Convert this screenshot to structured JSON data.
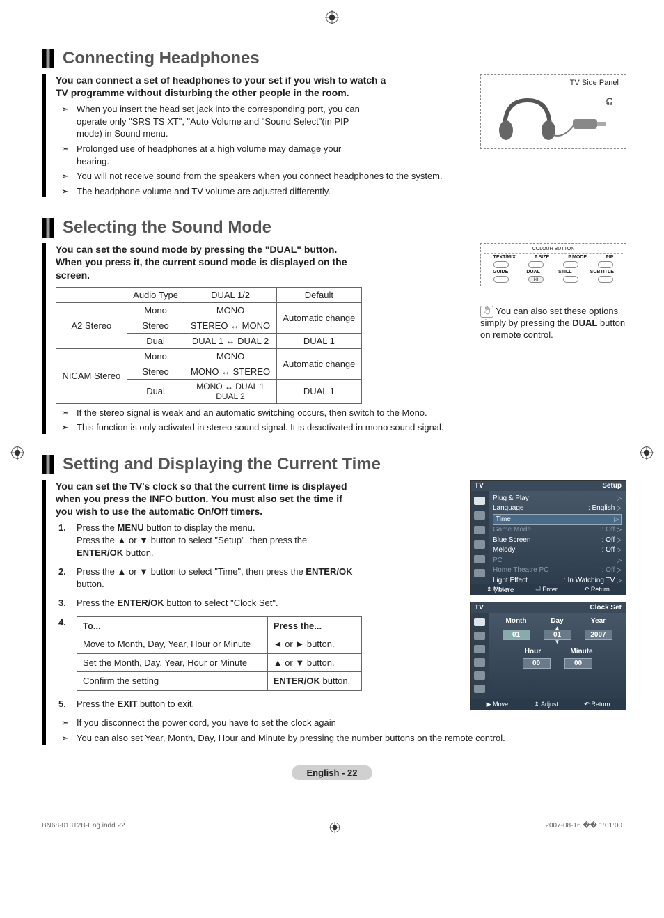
{
  "sections": {
    "headphones": {
      "heading": "Connecting Headphones",
      "intro": "You can connect a set of headphones to your set if you wish to watch a TV programme without disturbing the other people in the room.",
      "bullets": [
        "When you insert the head set jack into the corresponding port, you can operate only \"SRS TS XT\", \"Auto Volume  and \"Sound Select\"(in PIP mode)  in Sound menu.",
        "Prolonged use of headphones at a high volume may damage your hearing.",
        "You will not receive sound from the speakers when you connect headphones to the system.",
        "The headphone volume and TV volume  are adjusted differently."
      ],
      "panel_label": "TV Side Panel"
    },
    "soundmode": {
      "heading": "Selecting the Sound Mode",
      "intro": "You can set the sound mode by pressing the \"DUAL\" button. When you press it, the current sound mode is displayed on the screen.",
      "table": {
        "headers": [
          "",
          "Audio Type",
          "DUAL 1/2",
          "Default"
        ],
        "rows": [
          [
            "A2 Stereo",
            "Mono",
            "MONO",
            "Automatic change"
          ],
          [
            "",
            "Stereo",
            "STEREO ↔ MONO",
            ""
          ],
          [
            "",
            "Dual",
            "DUAL 1 ↔ DUAL 2",
            "DUAL 1"
          ],
          [
            "NICAM Stereo",
            "Mono",
            "MONO",
            "Automatic change"
          ],
          [
            "",
            "Stereo",
            "MONO ↔ STEREO",
            ""
          ],
          [
            "",
            "Dual",
            "MONO ↔ DUAL 1\nDUAL 2",
            "DUAL 1"
          ]
        ]
      },
      "bullets": [
        "If the stereo signal is weak and an automatic switching occurs, then switch to the Mono.",
        "This function is only activated in stereo sound signal. It is deactivated in mono sound signal."
      ],
      "remote_note_pre": "You can also set these options simply by pressing the ",
      "remote_note_bold": "DUAL",
      "remote_note_post": " button on remote control.",
      "remote_labels": {
        "title": "COLOUR BUTTON",
        "row1": [
          "TEXT/MIX",
          "P.SIZE",
          "P.MODE",
          "PIP"
        ],
        "row2": [
          "GUIDE",
          "DUAL",
          "STILL",
          "SUBTITLE"
        ]
      }
    },
    "time": {
      "heading": "Setting and Displaying the Current Time",
      "intro": "You can set the TV's clock so that the current time is displayed when you press the INFO button. You must also set the time if you wish to use the automatic On/Off timers.",
      "steps": [
        {
          "pre": "Press the ",
          "b": "MENU",
          "post": " button to display the menu.\nPress the ▲ or ▼ button to select \"Setup\", then press the ",
          "b2": "ENTER/OK",
          "post2": " button."
        },
        {
          "pre": "Press the ▲ or ▼ button to select \"Time\", then press the ",
          "b": "ENTER/OK",
          "post": " button."
        },
        {
          "pre": "Press the ",
          "b": "ENTER/OK",
          "post": " button to select \"Clock Set\"."
        }
      ],
      "press_table": {
        "headers": [
          "To...",
          "Press the..."
        ],
        "rows": [
          [
            "Move to Month, Day, Year, Hour or Minute",
            "◄ or ► button."
          ],
          [
            "Set the Month, Day, Year, Hour or Minute",
            "▲ or ▼ button."
          ],
          [
            "Confirm the setting",
            "ENTER/OK button."
          ]
        ]
      },
      "step5_pre": "Press the ",
      "step5_b": "EXIT",
      "step5_post": " button to exit.",
      "footer_bullets": [
        "If you disconnect the power cord, you have to set the clock again",
        "You can also set Year, Month, Day, Hour and Minute by pressing the number buttons on the remote control."
      ],
      "osd1": {
        "left": "TV",
        "right": "Setup",
        "items": [
          {
            "l": "Plug & Play",
            "v": "",
            "arrow": true
          },
          {
            "l": "Language",
            "v": ": English",
            "arrow": true
          },
          {
            "l": "Time",
            "v": "",
            "hl": true,
            "arrow": true
          },
          {
            "l": "Game Mode",
            "v": ": Off",
            "dim": true,
            "arrow": true
          },
          {
            "l": "Blue Screen",
            "v": ": Off",
            "arrow": true
          },
          {
            "l": "Melody",
            "v": ": Off",
            "arrow": true
          },
          {
            "l": "PC",
            "v": "",
            "dim": true,
            "arrow": true
          },
          {
            "l": "Home Theatre PC",
            "v": ": Off",
            "dim": true,
            "arrow": true
          },
          {
            "l": "Light Effect",
            "v": ": In Watching TV",
            "arrow": true
          },
          {
            "l": "▽More",
            "v": ""
          }
        ],
        "footer": [
          "⇕ Move",
          "⏎ Enter",
          "↶ Return"
        ]
      },
      "osd2": {
        "left": "TV",
        "right": "Clock Set",
        "cols1": [
          "Month",
          "Day",
          "Year"
        ],
        "vals1": [
          "01",
          "01",
          "2007"
        ],
        "cols2": [
          "Hour",
          "Minute"
        ],
        "vals2": [
          "00",
          "00"
        ],
        "footer": [
          "▶ Move",
          "⇕ Adjust",
          "↶ Return"
        ]
      }
    }
  },
  "page_label": "English - 22",
  "doc_footer": {
    "left": "BN68-01312B-Eng.indd   22",
    "right": "2007-08-16   �� 1:01:00"
  }
}
